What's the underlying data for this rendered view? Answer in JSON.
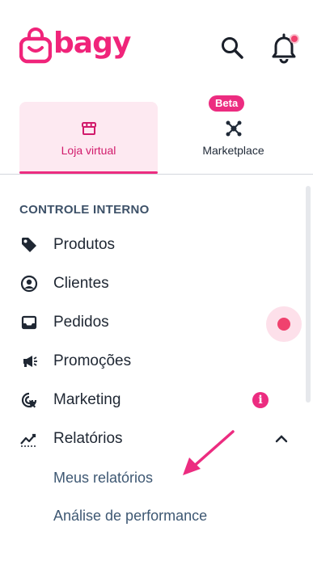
{
  "brand": {
    "logo_text": "bagy",
    "accent": "#ec2c80"
  },
  "header": {
    "search_icon": "search-icon",
    "bell_icon": "bell-icon",
    "notification_dot": "#f0426e"
  },
  "tabs": [
    {
      "label": "Loja virtual",
      "icon": "storefront-icon",
      "active": true
    },
    {
      "label": "Marketplace",
      "icon": "network-icon",
      "active": false,
      "badge": "Beta"
    }
  ],
  "section": {
    "title": "CONTROLE INTERNO"
  },
  "menu": [
    {
      "label": "Produtos",
      "icon": "tag-icon"
    },
    {
      "label": "Clientes",
      "icon": "user-circle-icon"
    },
    {
      "label": "Pedidos",
      "icon": "inbox-icon",
      "indicator": "pink-dot"
    },
    {
      "label": "Promoções",
      "icon": "megaphone-icon"
    },
    {
      "label": "Marketing",
      "icon": "cursor-click-icon",
      "indicator": "info-icon"
    },
    {
      "label": "Relatórios",
      "icon": "chart-line-icon",
      "expanded": true
    }
  ],
  "submenu": [
    {
      "label": "Meus relatórios"
    },
    {
      "label": "Análise de performance"
    }
  ]
}
